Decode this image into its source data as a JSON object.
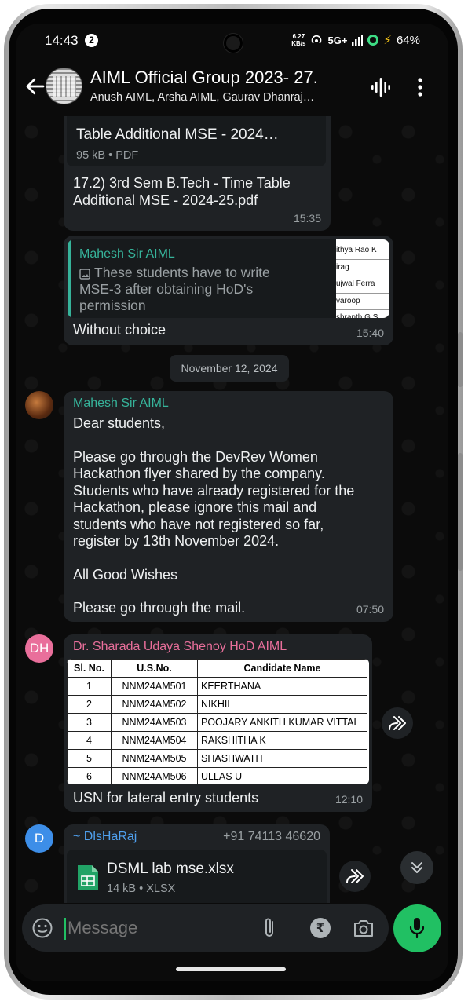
{
  "status": {
    "time": "14:43",
    "notif_count": "2",
    "speed_value": "6.27",
    "speed_unit": "KB/s",
    "network": "5G+",
    "battery": "64%"
  },
  "header": {
    "title": "AIML Official Group 2023- 27.",
    "subtitle": "Anush AIML, Arsha AIML, Gaurav Dhanraj…"
  },
  "messages": {
    "m1": {
      "file_title": "Table Additional MSE - 2024…",
      "file_meta": "95 kB • PDF",
      "caption_line1": "17.2) 3rd Sem B.Tech - Time Table",
      "caption_line2": "Additional MSE - 2024-25.pdf",
      "time": "15:35"
    },
    "m2": {
      "reply_sender": "Mahesh Sir AIML",
      "reply_text": "These students have to write MSE-3 after obtaining HoD's permission",
      "thumb_lines": [
        "ithya Rao K",
        "irag",
        "ujwal Ferra",
        "varoop",
        "shranth G S"
      ],
      "text": "Without choice",
      "time": "15:40"
    },
    "date_chip": "November 12, 2024",
    "m3": {
      "sender": "Mahesh Sir AIML",
      "p1": "Dear students,",
      "p2": "Please go through the DevRev Women Hackathon flyer shared by the company. Students who have already registered for the Hackathon, please ignore this mail and students who have not registered so far, register by 13th November 2024.",
      "p3": "All Good Wishes",
      "p4": "Please go through the mail.",
      "time": "07:50"
    },
    "m4": {
      "avatar": "DH",
      "sender": "Dr. Sharada Udaya Shenoy HoD AIML",
      "table_headers": [
        "Sl. No.",
        "U.S.No.",
        "Candidate Name"
      ],
      "rows": [
        [
          "1",
          "NNM24AM501",
          "KEERTHANA"
        ],
        [
          "2",
          "NNM24AM502",
          "NIKHIL"
        ],
        [
          "3",
          "NNM24AM503",
          "POOJARY ANKITH KUMAR VITTAL"
        ],
        [
          "4",
          "NNM24AM504",
          "RAKSHITHA K"
        ],
        [
          "5",
          "NNM24AM505",
          "SHASHWATH"
        ],
        [
          "6",
          "NNM24AM506",
          "ULLAS U"
        ]
      ],
      "caption": "USN for lateral entry students",
      "time": "12:10"
    },
    "m5": {
      "avatar": "D",
      "sender": "~ DlsHaRaj",
      "phone": "+91 74113 46620",
      "file_name": "DSML lab mse.xlsx",
      "file_meta": "14 kB • XLSX"
    }
  },
  "input": {
    "placeholder": "Message"
  },
  "colors": {
    "accent_green": "#21c063",
    "sender_teal": "#36b39a",
    "sender_pink": "#e96f9b",
    "bubble": "#1f2225"
  }
}
